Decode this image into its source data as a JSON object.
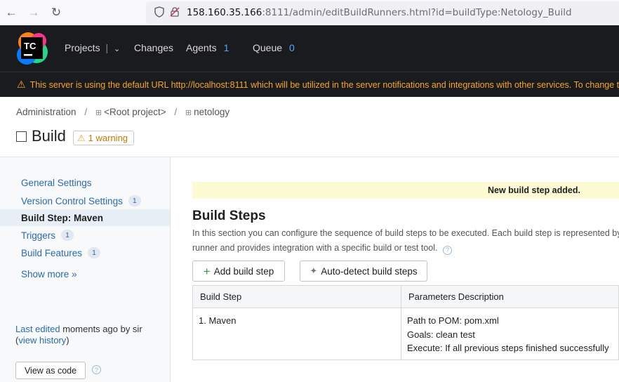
{
  "browser": {
    "url_host": "158.160.35.166",
    "url_path": ":8111/admin/editBuildRunners.html?id=buildType:Netology_Build"
  },
  "header": {
    "logo_text": "TC",
    "nav": {
      "projects": "Projects",
      "changes": "Changes",
      "agents": "Agents",
      "agents_count": "1",
      "queue": "Queue",
      "queue_count": "0"
    }
  },
  "warning_bar": {
    "text": "This server is using the default URL http://localhost:8111 which will be utilized in the server notifications and integrations with other services. To change the URL"
  },
  "breadcrumbs": {
    "administration": "Administration",
    "root_project": "<Root project>",
    "netology": "netology",
    "separator": "/"
  },
  "page": {
    "title": "Build",
    "warning_badge": "1 warning"
  },
  "sidebar": {
    "items": [
      {
        "label": "General Settings",
        "count": ""
      },
      {
        "label": "Version Control Settings",
        "count": "1"
      },
      {
        "label": "Build Step: Maven",
        "count": ""
      },
      {
        "label": "Triggers",
        "count": "1"
      },
      {
        "label": "Build Features",
        "count": "1"
      }
    ],
    "show_more": "Show more »",
    "last_edited_link": "Last edited",
    "last_edited_text": " moments ago by sir",
    "view_history_open": "(",
    "view_history": "view history",
    "view_history_close": ")",
    "view_as_code": "View as code"
  },
  "main": {
    "notice": "New build step added.",
    "title": "Build Steps",
    "description_line1": "In this section you can configure the sequence of build steps to be executed. Each build step is represented by a build",
    "description_line2": "runner and provides integration with a specific build or test tool.",
    "add_build_step": "Add build step",
    "auto_detect": "Auto-detect build steps",
    "table": {
      "headers": [
        "Build Step",
        "Parameters Description"
      ],
      "rows": [
        {
          "step": "1. Maven",
          "params": [
            "Path to POM: pom.xml",
            "Goals: clean test",
            "Execute: If all previous steps finished successfully"
          ]
        }
      ]
    }
  },
  "colors": {
    "link": "#2a69b4",
    "header_bg": "#1a1b1f",
    "warning_text": "#f5a623",
    "notice_bg": "#fdfbd3"
  }
}
